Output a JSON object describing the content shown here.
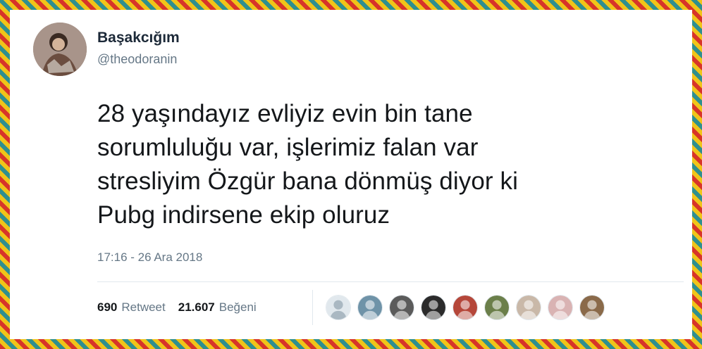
{
  "tweet": {
    "author_name": "Başakcığım",
    "author_handle": "@theodoranin",
    "text": "28 yaşındayız evliyiz evin bin tane\nsorumluluğu var, işlerimiz falan var\nstresliyim Özgür bana dönmüş diyor ki\nPubg indirsene ekip oluruz",
    "timestamp": "17:16 - 26 Ara 2018",
    "retweet_count": "690",
    "retweet_label": "Retweet",
    "like_count": "21.607",
    "like_label": "Beğeni"
  },
  "likers": [
    {
      "icon": "default-avatar-icon",
      "color": "#aab8c2"
    },
    {
      "icon": "user-avatar-icon",
      "color": "#6f93a8"
    },
    {
      "icon": "user-avatar-icon",
      "color": "#5b5b5b"
    },
    {
      "icon": "user-avatar-icon",
      "color": "#2b2b2b"
    },
    {
      "icon": "user-avatar-icon",
      "color": "#b5473a"
    },
    {
      "icon": "user-avatar-icon",
      "color": "#6b7f4a"
    },
    {
      "icon": "user-avatar-icon",
      "color": "#c9b8a8"
    },
    {
      "icon": "user-avatar-icon",
      "color": "#d9b3b3"
    },
    {
      "icon": "user-avatar-icon",
      "color": "#8a6a4a"
    }
  ],
  "colors": {
    "name": "#1c2938",
    "secondary": "#657786",
    "text": "#14171a",
    "divider": "#e1e8ed",
    "border_pattern": [
      "#d7342a",
      "#f0c419",
      "#2f8f8f"
    ]
  }
}
